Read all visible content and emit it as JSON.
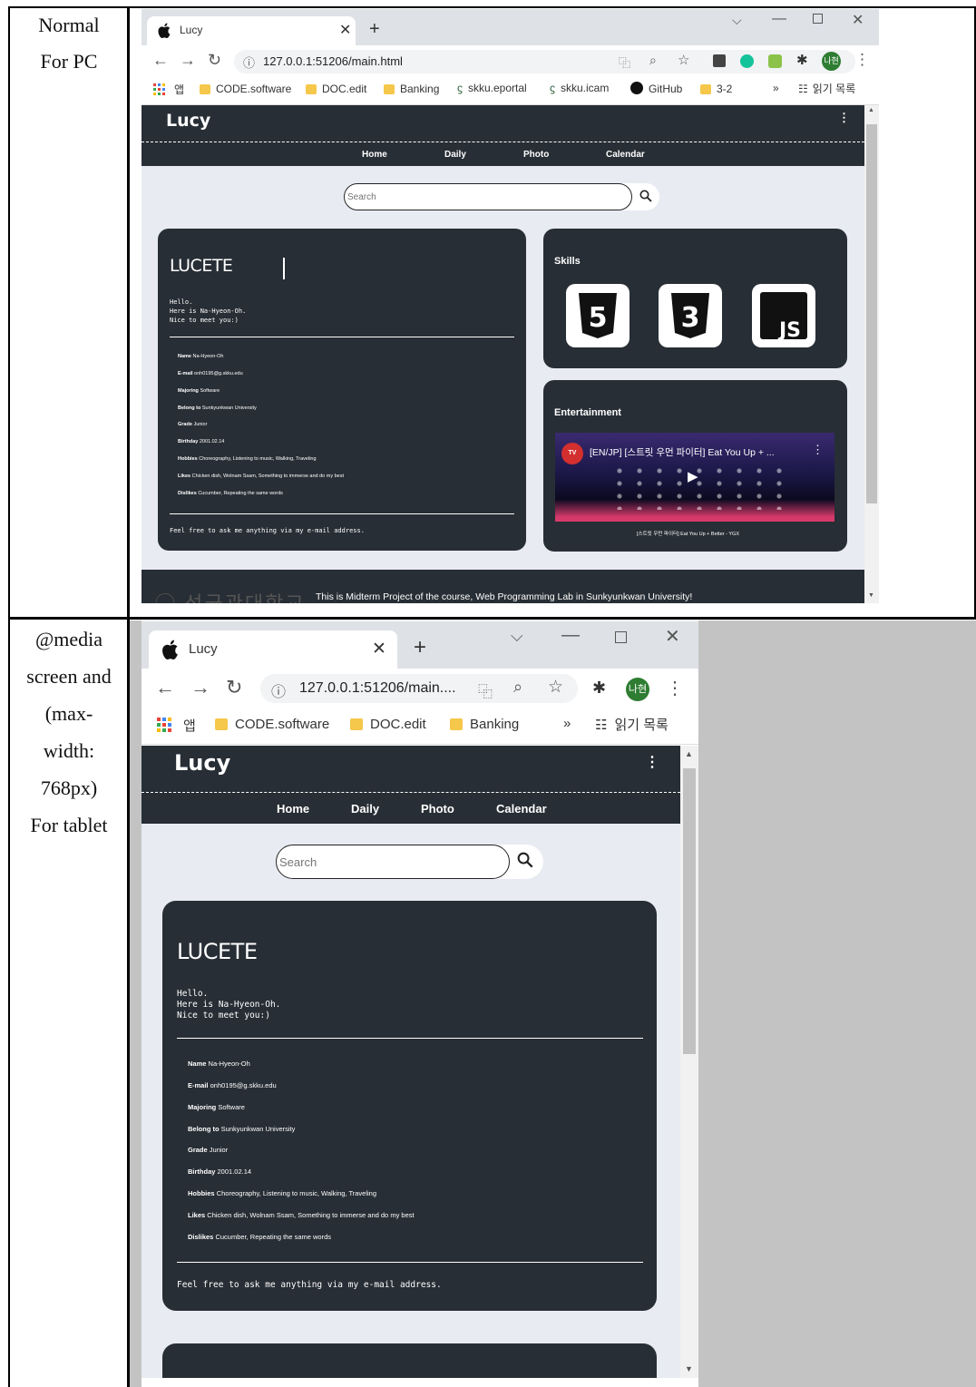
{
  "labels": {
    "row1": [
      "Normal",
      "For PC"
    ],
    "row2": [
      "@media",
      "screen and",
      "(max-",
      "width:",
      "768px)",
      "For tablet"
    ]
  },
  "browser_pc": {
    "tab_title": "Lucy",
    "url": "127.0.0.1:51206/main.html",
    "bookmarks": [
      "앱",
      "CODE.software",
      "DOC.edit",
      "Banking",
      "skku.eportal",
      "skku.icam",
      "GitHub",
      "3-2",
      "»",
      "읽기 목록"
    ],
    "profile_badge": "나현"
  },
  "browser_tablet": {
    "tab_title": "Lucy",
    "url": "127.0.0.1:51206/main....",
    "bookmarks": [
      "앱",
      "CODE.software",
      "DOC.edit",
      "Banking",
      "»",
      "읽기 목록"
    ],
    "profile_badge": "나현"
  },
  "site": {
    "logo": "Lucy",
    "kebab": "⋮",
    "nav": [
      "Home",
      "Daily",
      "Photo",
      "Calendar"
    ],
    "search_placeholder": "Search",
    "profile": {
      "title": "LUCETE",
      "greeting": "Hello.\nHere is Na-Hyeon-Oh.\nNice to meet you:)",
      "rows": [
        {
          "k": "Name",
          "v": "Na-Hyeon-Oh"
        },
        {
          "k": "E-mail",
          "v": "onh0195@g.skku.edu"
        },
        {
          "k": "Majoring",
          "v": "Software"
        },
        {
          "k": "Belong to",
          "v": "Sunkyunkwan University"
        },
        {
          "k": "Grade",
          "v": "Junior"
        },
        {
          "k": "Birthday",
          "v": "2001.02.14"
        },
        {
          "k": "Hobbies",
          "v": "Choreography, Listening to music, Walking, Traveling"
        },
        {
          "k": "Likes",
          "v": "Chicken dish, Wolnam Ssam, Something to immerse and do my best"
        },
        {
          "k": "Dislikes",
          "v": "Cucumber, Repeating the same words"
        }
      ],
      "footer": "Feel free to ask me anything via my e-mail address."
    },
    "skills_title": "Skills",
    "skills": [
      "5",
      "3",
      "JS"
    ],
    "entertainment_title": "Entertainment",
    "video_title": "[EN/JP] [스트릿 우먼 파이터] Eat You Up + ...",
    "video_caption": "[스트릿 우먼 파이터] Eat You Up + Better - YGX",
    "video_channel": "TV",
    "footer_text": "This is Midterm Project of the course, Web Programming Lab in Sunkyunkwan University!"
  }
}
